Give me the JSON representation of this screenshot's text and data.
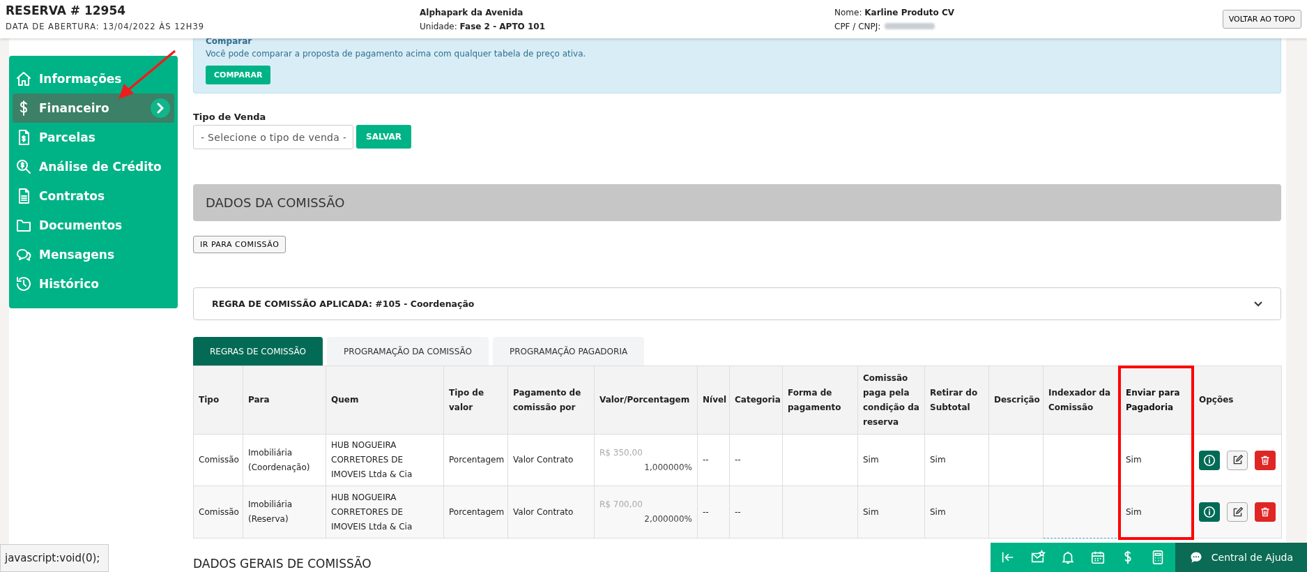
{
  "header": {
    "title": "RESERVA # 12954",
    "opened": "DATA DE ABERTURA: 13/04/2022 ÀS 12H39",
    "project": "Alphapark da Avenida",
    "unit": "Unidade: **Fase 2 - APTO 101**",
    "client": "Nome: **Karline Produto CV**",
    "document_label": "CPF / CNPJ:",
    "top_button": "VOLTAR AO TOPO"
  },
  "sidebar": {
    "items": [
      {
        "label": "Informações",
        "kind": "home",
        "selected": false
      },
      {
        "label": "Financeiro",
        "kind": "dollar",
        "selected": true
      },
      {
        "label": "Parcelas",
        "kind": "invoice",
        "selected": false
      },
      {
        "label": "Análise de Crédito",
        "kind": "credit",
        "selected": false
      },
      {
        "label": "Contratos",
        "kind": "document",
        "selected": false
      },
      {
        "label": "Documentos",
        "kind": "folder",
        "selected": false
      },
      {
        "label": "Mensagens",
        "kind": "chat",
        "selected": false
      },
      {
        "label": "Histórico",
        "kind": "history",
        "selected": false
      }
    ]
  },
  "compare_panel": {
    "title": "Comparar",
    "text": "Você pode comparar a proposta de pagamento acima com qualquer tabela de preço ativa.",
    "button": "COMPARAR"
  },
  "sale_type": {
    "label": "Tipo de Venda",
    "placeholder": "- Selecione o tipo de venda -",
    "button": "SALVAR"
  },
  "commission_section": {
    "title": "DADOS DA COMISSÃO",
    "button": "IR PARA COMISSÃO"
  },
  "applied_rule": {
    "title": "REGRA DE COMISSÃO APLICADA: #105 - Coordenação",
    "expanded": false
  },
  "tabs": [
    {
      "label": "REGRAS DE COMISSÃO",
      "selected": true
    },
    {
      "label": "PROGRAMAÇÃO DA COMISSÃO",
      "selected": false
    },
    {
      "label": "PROGRAMAÇÃO PAGADORIA",
      "selected": false
    }
  ],
  "table": {
    "columns": [
      {
        "label": "Tipo",
        "highlighted": false
      },
      {
        "label": "Para",
        "highlighted": false
      },
      {
        "label": "Quem",
        "highlighted": false
      },
      {
        "label": "Tipo de valor",
        "highlighted": false
      },
      {
        "label": "Pagamento de comissão por",
        "highlighted": false
      },
      {
        "label": "Valor/Porcentagem",
        "highlighted": false
      },
      {
        "label": "Nível",
        "highlighted": false
      },
      {
        "label": "Categoria",
        "highlighted": false
      },
      {
        "label": "Forma de pagamento",
        "highlighted": false
      },
      {
        "label": "Comissão paga pela condição da reserva",
        "highlighted": false
      },
      {
        "label": "Retirar do Subtotal",
        "highlighted": false
      },
      {
        "label": "Descrição",
        "highlighted": false
      },
      {
        "label": "Indexador da Comissão",
        "highlighted": false
      },
      {
        "label": "Enviar para Pagadoria",
        "highlighted": true
      },
      {
        "label": "Opções",
        "highlighted": false
      }
    ],
    "rows": [
      {
        "tipo": "Comissão",
        "para": "Imobiliária (Coordenação)",
        "quem": "HUB NOGUEIRA CORRETORES DE IMOVEIS Ltda & Cia",
        "tipo_valor": "Porcentagem",
        "pagamento_por": "Valor Contrato",
        "valor": "R$ 350,00",
        "porcentagem": "1,000000%",
        "nivel": "--",
        "categoria": "--",
        "condicao_reserva": "Sim",
        "retirar_subtotal": "Sim",
        "enviar_pagadoria": "Sim"
      },
      {
        "tipo": "Comissão",
        "para": "Imobiliária (Reserva)",
        "quem": "HUB NOGUEIRA CORRETORES DE IMOVEIS Ltda & Cia",
        "tipo_valor": "Porcentagem",
        "pagamento_por": "Valor Contrato",
        "valor": "R$ 700,00",
        "porcentagem": "2,000000%",
        "nivel": "--",
        "categoria": "--",
        "condicao_reserva": "Sim",
        "retirar_subtotal": "Sim",
        "enviar_pagadoria": "Sim"
      }
    ]
  },
  "general_section": {
    "title": "DADOS GERAIS DE COMISSÃO"
  },
  "status_tooltip": "javascript:void(0);",
  "help_button": "Central de Ajuda"
}
